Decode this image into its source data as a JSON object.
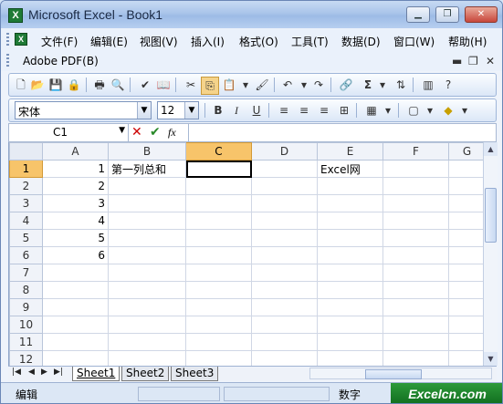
{
  "window": {
    "title": "Microsoft Excel - Book1",
    "app_icon": "excel-icon"
  },
  "menubar": {
    "items": [
      "文件(F)",
      "编辑(E)",
      "视图(V)",
      "插入(I)",
      "格式(O)",
      "工具(T)",
      "数据(D)",
      "窗口(W)",
      "帮助(H)"
    ],
    "pdf_menu": "Adobe PDF(B)"
  },
  "formatting": {
    "font_name": "宋体",
    "font_size": "12"
  },
  "formula_bar": {
    "name_box": "C1",
    "fx_label": "fx",
    "value": ""
  },
  "sheet": {
    "columns": [
      "A",
      "B",
      "C",
      "D",
      "E",
      "F",
      "G"
    ],
    "rows": [
      {
        "num": "1",
        "cells": [
          "1",
          "第一列总和",
          "",
          "",
          "Excel网",
          "",
          ""
        ]
      },
      {
        "num": "2",
        "cells": [
          "2",
          "",
          "",
          "",
          "",
          "",
          ""
        ]
      },
      {
        "num": "3",
        "cells": [
          "3",
          "",
          "",
          "",
          "",
          "",
          ""
        ]
      },
      {
        "num": "4",
        "cells": [
          "4",
          "",
          "",
          "",
          "",
          "",
          ""
        ]
      },
      {
        "num": "5",
        "cells": [
          "5",
          "",
          "",
          "",
          "",
          "",
          ""
        ]
      },
      {
        "num": "6",
        "cells": [
          "6",
          "",
          "",
          "",
          "",
          "",
          ""
        ]
      },
      {
        "num": "7",
        "cells": [
          "",
          "",
          "",
          "",
          "",
          "",
          ""
        ]
      },
      {
        "num": "8",
        "cells": [
          "",
          "",
          "",
          "",
          "",
          "",
          ""
        ]
      },
      {
        "num": "9",
        "cells": [
          "",
          "",
          "",
          "",
          "",
          "",
          ""
        ]
      },
      {
        "num": "10",
        "cells": [
          "",
          "",
          "",
          "",
          "",
          "",
          ""
        ]
      },
      {
        "num": "11",
        "cells": [
          "",
          "",
          "",
          "",
          "",
          "",
          ""
        ]
      },
      {
        "num": "12",
        "cells": [
          "",
          "",
          "",
          "",
          "",
          "",
          ""
        ]
      }
    ],
    "active_cell": "C1"
  },
  "tabs": [
    "Sheet1",
    "Sheet2",
    "Sheet3"
  ],
  "status": {
    "mode": "编辑",
    "num": "数字"
  },
  "watermark": "Excelcn.com",
  "colors": {
    "active_header": "#f7c46a",
    "title_grad": "#a9c4ea"
  }
}
